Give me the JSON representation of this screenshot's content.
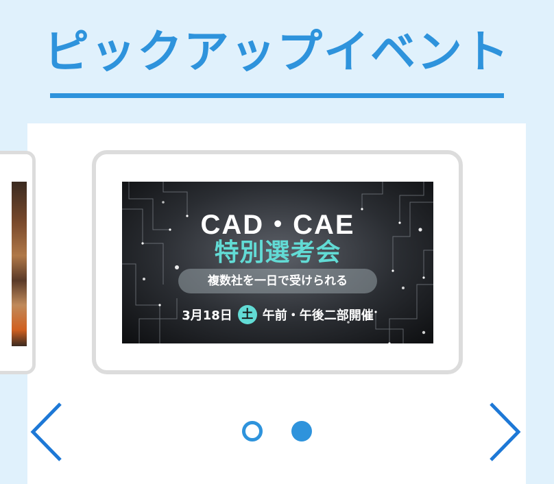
{
  "section": {
    "title": "ピックアップイベント"
  },
  "slide": {
    "banner_title": "CAD・CAE",
    "banner_subtitle": "特別選考会",
    "pill_text": "複数社を一日で受けられる",
    "date_text": "3月18日",
    "day_badge": "土",
    "session_text": "午前・午後二部開催"
  },
  "carousel": {
    "slide_count": 2,
    "active_index": 1
  },
  "colors": {
    "accent": "#2e93dc",
    "background": "#e0f1fc",
    "banner_highlight": "#62dbd5",
    "card_border": "#dcdcdc"
  },
  "icons": {
    "prev": "chevron-left-icon",
    "next": "chevron-right-icon"
  }
}
